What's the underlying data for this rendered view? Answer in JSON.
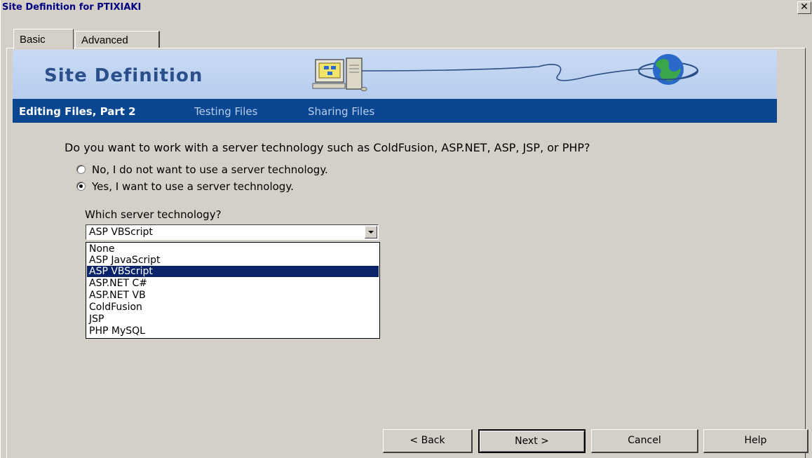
{
  "window": {
    "title": "Site Definition for PTIXIAKI",
    "close_glyph": "✕"
  },
  "tabs": [
    {
      "label": "Basic",
      "active": true
    },
    {
      "label": "Advanced",
      "active": false
    }
  ],
  "banner": {
    "title": "Site Definition",
    "icons": [
      "computer-icon",
      "globe-icon"
    ]
  },
  "steps": [
    {
      "label": "Editing Files, Part 2",
      "current": true
    },
    {
      "label": "Testing Files",
      "current": false
    },
    {
      "label": "Sharing Files",
      "current": false
    }
  ],
  "question": "Do you want to work with a server technology such as ColdFusion, ASP.NET, ASP, JSP, or PHP?",
  "radios": [
    {
      "label": "No, I do not want to use a server technology.",
      "checked": false
    },
    {
      "label": "Yes, I want to use a server technology.",
      "checked": true
    }
  ],
  "server_tech": {
    "label": "Which server technology?",
    "selected": "ASP VBScript",
    "options": [
      "None",
      "ASP JavaScript",
      "ASP VBScript",
      "ASP.NET C#",
      "ASP.NET VB",
      "ColdFusion",
      "JSP",
      "PHP MySQL"
    ]
  },
  "buttons": {
    "back": "< Back",
    "next": "Next >",
    "cancel": "Cancel",
    "help": "Help"
  },
  "colors": {
    "window_bg": "#d4d0c8",
    "step_bar": "#0b4790",
    "selection": "#0a246a",
    "title_text": "#000080"
  }
}
